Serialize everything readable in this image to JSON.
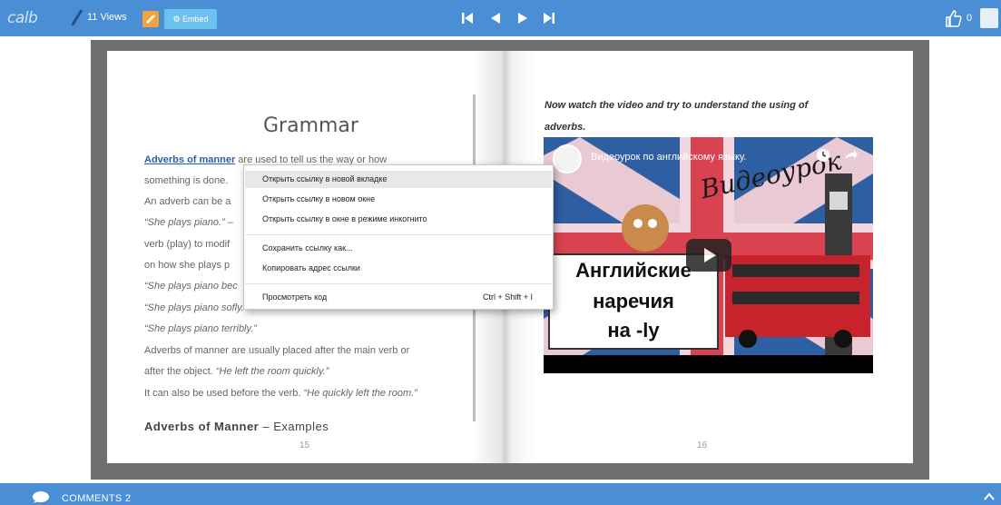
{
  "toolbar": {
    "logo_text": "calb",
    "views_label": "11 Views",
    "embed_label": "⚙ Embed",
    "like_count": "0",
    "colors": {
      "bar": "#4a8fd6",
      "edit": "#f2a33c",
      "embed": "#6cc1ee"
    },
    "nav_icons": [
      "first-page-icon",
      "prev-page-icon",
      "next-page-icon",
      "last-page-icon"
    ]
  },
  "left_page": {
    "title": "Grammar",
    "lines": [
      {
        "link": "Adverbs of manner",
        "text": " are used to tell us the way or how"
      },
      {
        "text": "something is done."
      },
      {
        "text": "An adverb can be a"
      },
      {
        "italic": "“She plays piano.” –"
      },
      {
        "text": "verb (play) to modif"
      },
      {
        "text": "on how she plays p"
      },
      {
        "italic": "“She plays piano bec"
      },
      {
        "italic": "“She plays piano sofly."
      },
      {
        "italic": "“She plays piano terribly.”"
      },
      {
        "text": "Adverbs of manner are usually placed after the main verb or"
      },
      {
        "text": "after the object. ",
        "italic_tail": "“He left the room quickly.”"
      },
      {
        "text": "It can also be used before the verb. ",
        "italic_tail": "“He quickly left the room.”"
      }
    ],
    "examples_heading_bold": "Adverbs of Manner",
    "examples_heading_rest": " – Examples",
    "page_number": "15"
  },
  "context_menu": {
    "items": [
      "Открыть ссылку в новой вкладке",
      "Открыть ссылку в новом окне",
      "Открыть ссылку в окне в режиме инкогнито",
      "Сохранить ссылку как...",
      "Копировать адрес ссылки",
      "Просмотреть код"
    ],
    "inspect_shortcut": "Ctrl + Shift + I"
  },
  "right_page": {
    "instruction_line1": "Now watch the video and try to understand the using of",
    "instruction_line2": "adverbs.",
    "page_number": "16",
    "video": {
      "title": "Видеоурок по английскому языку.",
      "overlay_word": "Видеоурок",
      "card_line1": "Английские",
      "card_line2": "наречия",
      "card_line3": "на -ly"
    }
  },
  "bottom": {
    "comments_label": "COMMENTS 2"
  }
}
